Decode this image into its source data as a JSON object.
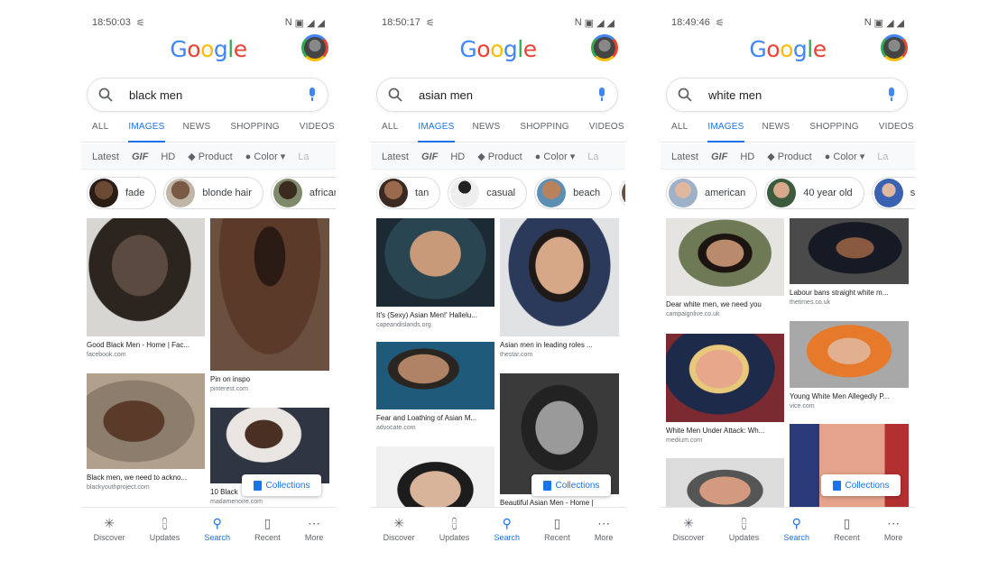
{
  "colors": {
    "google_blue": "#4285F4",
    "google_red": "#EA4335",
    "google_yellow": "#FBBC05",
    "google_green": "#34A853",
    "active": "#1A73E8"
  },
  "tabs": [
    "ALL",
    "IMAGES",
    "NEWS",
    "SHOPPING",
    "VIDEOS"
  ],
  "filters": [
    "Latest",
    "GIF",
    "HD",
    "Product",
    "Color",
    "La"
  ],
  "nav": [
    {
      "label": "Discover",
      "icon": "asterisk-icon"
    },
    {
      "label": "Updates",
      "icon": "updates-icon"
    },
    {
      "label": "Search",
      "icon": "search-icon"
    },
    {
      "label": "Recent",
      "icon": "recent-icon"
    },
    {
      "label": "More",
      "icon": "more-dots-icon"
    }
  ],
  "collections_label": "Collections",
  "phones": [
    {
      "time": "18:50:03",
      "query": "black men",
      "chips": [
        "fade",
        "blonde hair",
        "african"
      ],
      "cards": [
        {
          "caption": "Good Black Men - Home | Fac...",
          "source": "facebook.com"
        },
        {
          "caption": "Pin on inspo",
          "source": "pinterest.com"
        },
        {
          "caption": "Black men, we need to ackno...",
          "source": "blackyouthproject.com"
        },
        {
          "caption": "10 Black",
          "source": "madamenoire.com"
        }
      ]
    },
    {
      "time": "18:50:17",
      "query": "asian men",
      "chips": [
        "tan",
        "casual",
        "beach",
        ""
      ],
      "cards": [
        {
          "caption": "It's (Sexy) Asian Men!' Hallelu...",
          "source": "capeandislands.org"
        },
        {
          "caption": "Asian men in leading roles ...",
          "source": "thestar.com"
        },
        {
          "caption": "Fear and Loathing of Asian M...",
          "source": "advocate.com"
        },
        {
          "caption": "Beautiful Asian Men - Home |",
          "source": ""
        }
      ]
    },
    {
      "time": "18:49:46",
      "query": "white men",
      "chips": [
        "american",
        "40 year old",
        "st"
      ],
      "cards": [
        {
          "caption": "Dear white men, we need you",
          "source": "campaignlive.co.uk"
        },
        {
          "caption": "Labour bans straight white m...",
          "source": "thetimes.co.uk"
        },
        {
          "caption": "White Men Under Attack: Wh...",
          "source": "medium.com"
        },
        {
          "caption": "Young White Men Allegedly P...",
          "source": "vice.com"
        }
      ]
    }
  ]
}
